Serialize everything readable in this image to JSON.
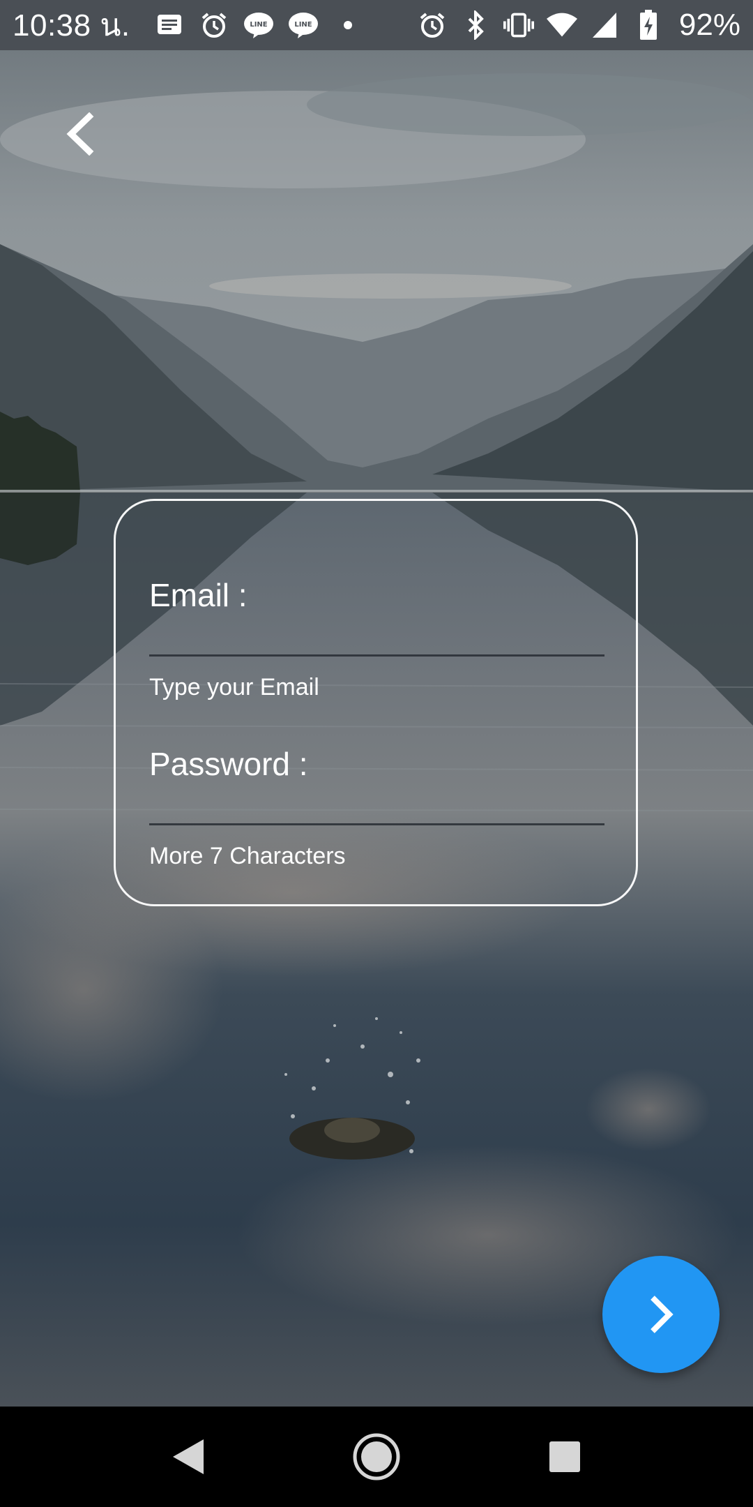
{
  "status_bar": {
    "time": "10:38 น.",
    "battery": "92%",
    "left_icons": [
      "message-icon",
      "alarm-icon",
      "line-app-icon",
      "line-app-icon",
      "dot-icon"
    ],
    "right_icons": [
      "alarm-icon",
      "bluetooth-icon",
      "vibrate-icon",
      "wifi-icon",
      "signal-icon",
      "battery-charging-icon"
    ],
    "line_badge": "LINE"
  },
  "header": {
    "back_icon": "chevron-left-icon"
  },
  "login_form": {
    "email_label": "Email :",
    "email_value": "",
    "email_hint": "Type your Email",
    "password_label": "Password :",
    "password_value": "",
    "password_hint": "More 7 Characters"
  },
  "fab": {
    "icon": "chevron-right-icon",
    "color": "#2196f3"
  },
  "nav_bar": {
    "icons": [
      "back-triangle-icon",
      "home-circle-icon",
      "recents-square-icon"
    ]
  }
}
